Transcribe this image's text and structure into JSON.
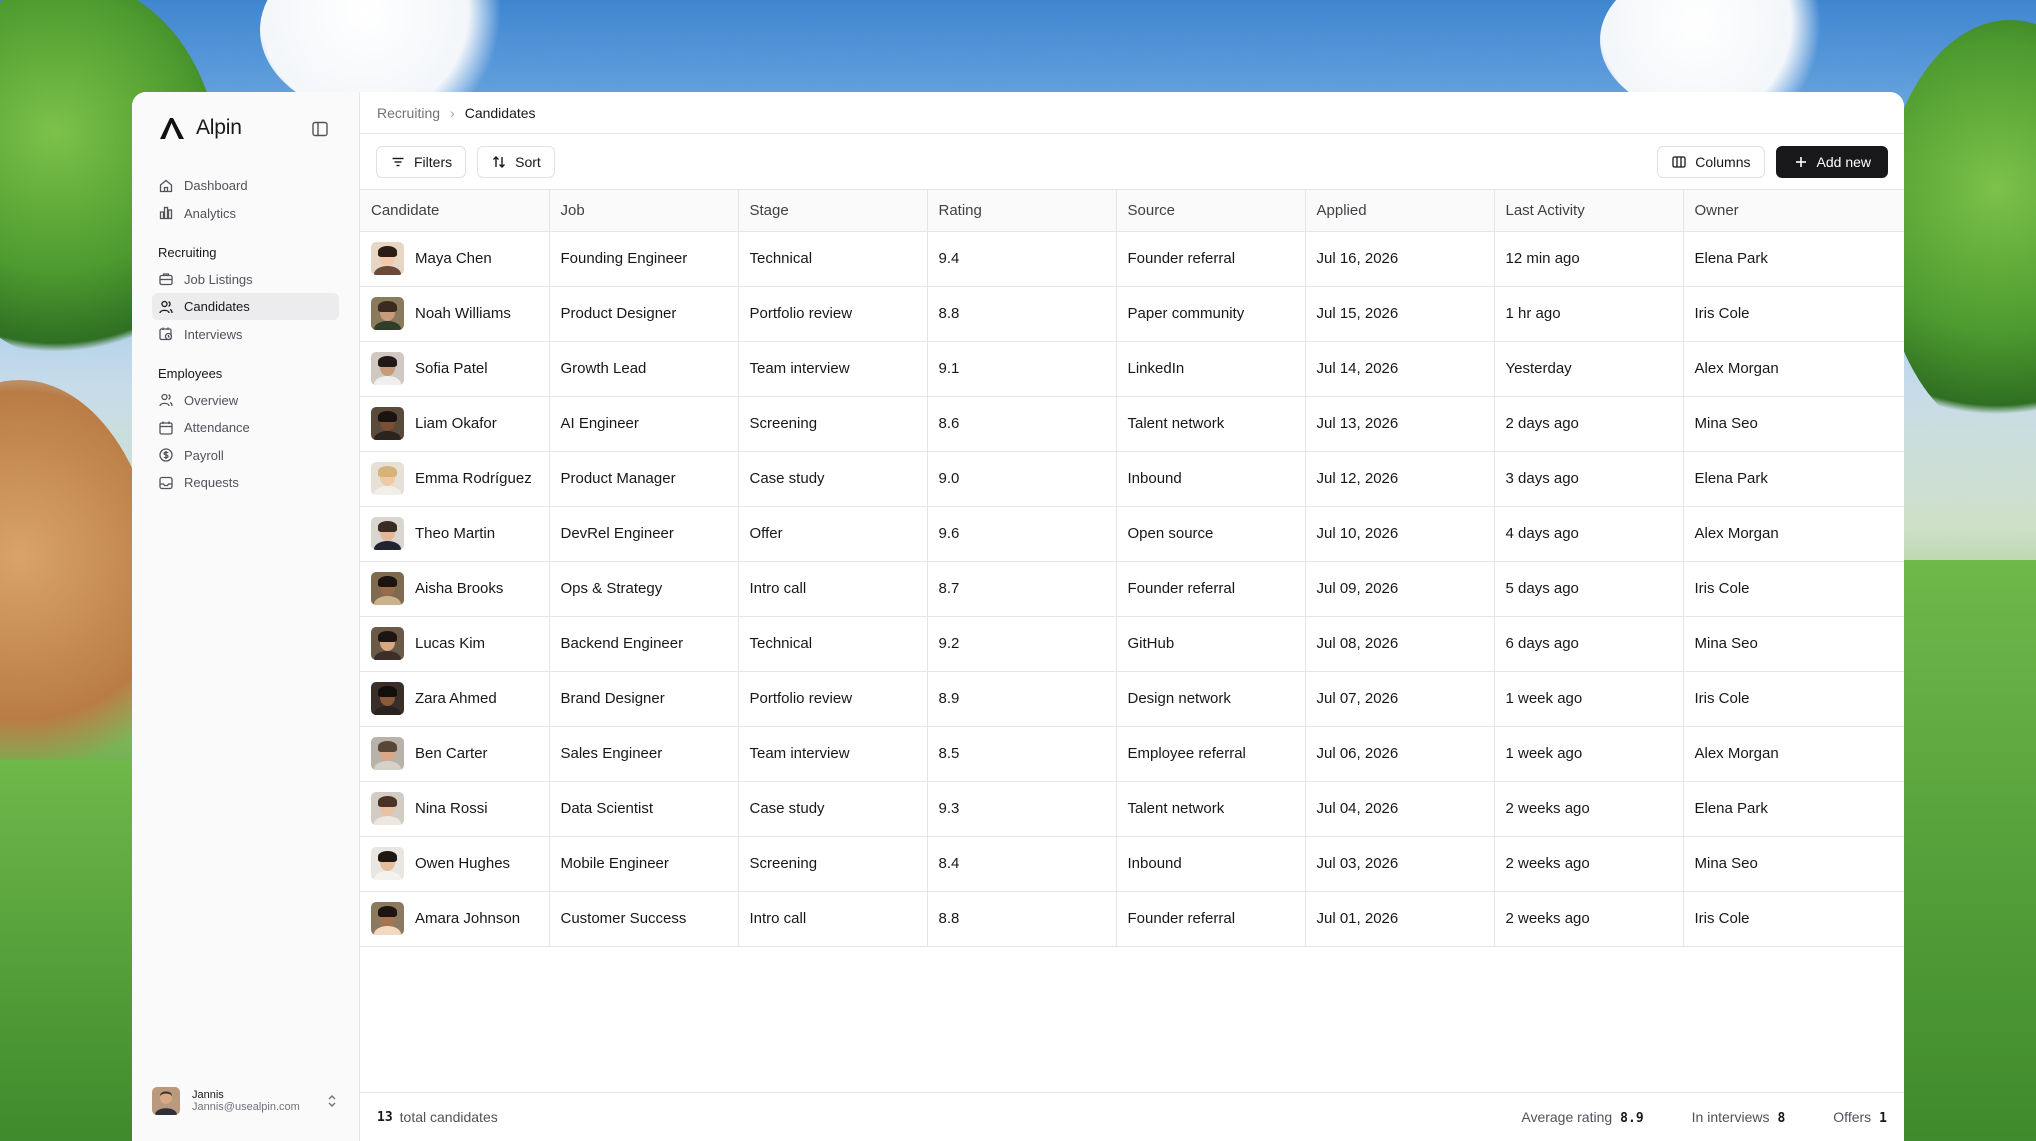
{
  "brand": {
    "name": "Alpin"
  },
  "sidebar": {
    "top_items": [
      {
        "label": "Dashboard",
        "icon": "home-icon"
      },
      {
        "label": "Analytics",
        "icon": "bar-chart-icon"
      }
    ],
    "groups": [
      {
        "label": "Recruiting",
        "items": [
          {
            "label": "Job Listings",
            "icon": "briefcase-icon"
          },
          {
            "label": "Candidates",
            "icon": "users-icon",
            "active": true
          },
          {
            "label": "Interviews",
            "icon": "calendar-clock-icon"
          }
        ]
      },
      {
        "label": "Employees",
        "items": [
          {
            "label": "Overview",
            "icon": "users-icon"
          },
          {
            "label": "Attendance",
            "icon": "calendar-icon"
          },
          {
            "label": "Payroll",
            "icon": "dollar-circle-icon"
          },
          {
            "label": "Requests",
            "icon": "inbox-icon"
          }
        ]
      }
    ]
  },
  "user": {
    "name": "Jannis",
    "email": "Jannis@usealpin.com"
  },
  "breadcrumb": {
    "parent": "Recruiting",
    "current": "Candidates"
  },
  "toolbar": {
    "filters": "Filters",
    "sort": "Sort",
    "columns": "Columns",
    "add_new": "Add new"
  },
  "table": {
    "headers": [
      "Candidate",
      "Job",
      "Stage",
      "Rating",
      "Source",
      "Applied",
      "Last Activity",
      "Owner"
    ],
    "rows": [
      [
        "Maya Chen",
        "Founding Engineer",
        "Technical",
        "9.4",
        "Founder referral",
        "Jul 16, 2026",
        "12 min ago",
        "Elena Park"
      ],
      [
        "Noah Williams",
        "Product Designer",
        "Portfolio review",
        "8.8",
        "Paper community",
        "Jul 15, 2026",
        "1 hr ago",
        "Iris Cole"
      ],
      [
        "Sofia Patel",
        "Growth Lead",
        "Team interview",
        "9.1",
        "LinkedIn",
        "Jul 14, 2026",
        "Yesterday",
        "Alex Morgan"
      ],
      [
        "Liam Okafor",
        "AI Engineer",
        "Screening",
        "8.6",
        "Talent network",
        "Jul 13, 2026",
        "2 days ago",
        "Mina Seo"
      ],
      [
        "Emma Rodríguez",
        "Product Manager",
        "Case study",
        "9.0",
        "Inbound",
        "Jul 12, 2026",
        "3 days ago",
        "Elena Park"
      ],
      [
        "Theo Martin",
        "DevRel Engineer",
        "Offer",
        "9.6",
        "Open source",
        "Jul 10, 2026",
        "4 days ago",
        "Alex Morgan"
      ],
      [
        "Aisha Brooks",
        "Ops & Strategy",
        "Intro call",
        "8.7",
        "Founder referral",
        "Jul 09, 2026",
        "5 days ago",
        "Iris Cole"
      ],
      [
        "Lucas Kim",
        "Backend Engineer",
        "Technical",
        "9.2",
        "GitHub",
        "Jul 08, 2026",
        "6 days ago",
        "Mina Seo"
      ],
      [
        "Zara Ahmed",
        "Brand Designer",
        "Portfolio review",
        "8.9",
        "Design network",
        "Jul 07, 2026",
        "1 week ago",
        "Iris Cole"
      ],
      [
        "Ben Carter",
        "Sales Engineer",
        "Team interview",
        "8.5",
        "Employee referral",
        "Jul 06, 2026",
        "1 week ago",
        "Alex Morgan"
      ],
      [
        "Nina Rossi",
        "Data Scientist",
        "Case study",
        "9.3",
        "Talent network",
        "Jul 04, 2026",
        "2 weeks ago",
        "Elena Park"
      ],
      [
        "Owen Hughes",
        "Mobile Engineer",
        "Screening",
        "8.4",
        "Inbound",
        "Jul 03, 2026",
        "2 weeks ago",
        "Mina Seo"
      ],
      [
        "Amara Johnson",
        "Customer Success",
        "Intro call",
        "8.8",
        "Founder referral",
        "Jul 01, 2026",
        "2 weeks ago",
        "Iris Cole"
      ]
    ],
    "avatar_colors": [
      [
        "#e8d6c4",
        "#f2c9a8",
        "#2b1d16",
        "#6b4a3a"
      ],
      [
        "#8a7b5c",
        "#c89b7b",
        "#3b2a20",
        "#2f3d2a"
      ],
      [
        "#cfc9c2",
        "#c79a7a",
        "#1f1a18",
        "#efefef"
      ],
      [
        "#5a4a3a",
        "#7a4f35",
        "#1a1411",
        "#2a2320"
      ],
      [
        "#e7e0d6",
        "#f0c9a6",
        "#d7b37a",
        "#f2efe9"
      ],
      [
        "#d9d5cf",
        "#e4b896",
        "#3a2b23",
        "#1f2430"
      ],
      [
        "#7f6a4f",
        "#9a6b4a",
        "#1b1411",
        "#c9b28d"
      ],
      [
        "#6c5a48",
        "#d8a884",
        "#1c1512",
        "#3b2f28"
      ],
      [
        "#3a2e28",
        "#8a5a3c",
        "#120e0c",
        "#2a2220"
      ],
      [
        "#b9b2a8",
        "#d9a888",
        "#5a4638",
        "#d6d1c9"
      ],
      [
        "#d2ccc5",
        "#e9c0a0",
        "#4a3326",
        "#ede7df"
      ],
      [
        "#e9e6e2",
        "#e6bd9b",
        "#1f1712",
        "#f4f2ef"
      ],
      [
        "#8c7a60",
        "#a8724f",
        "#1c1410",
        "#f2d8c0"
      ]
    ]
  },
  "footer": {
    "count": "13",
    "count_label": "total candidates",
    "avg_label": "Average rating",
    "avg_value": "8.9",
    "interviews_label": "In interviews",
    "interviews_value": "8",
    "offers_label": "Offers",
    "offers_value": "1"
  }
}
